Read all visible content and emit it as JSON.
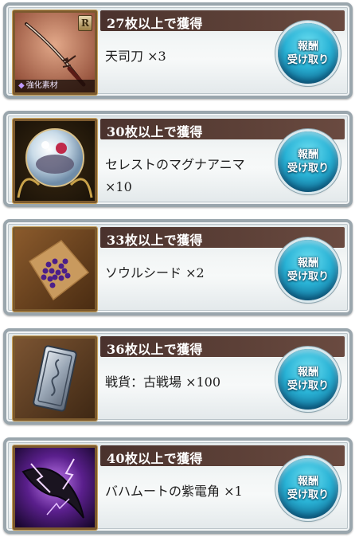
{
  "button_label_line1": "報酬",
  "button_label_line2": "受け取り",
  "rewards": [
    {
      "threshold": "27枚以上で獲得",
      "name": "天司刀 ×3",
      "badge": "R",
      "tag": "強化素材",
      "icon": "sword-item-icon"
    },
    {
      "threshold": "30枚以上で獲得",
      "name": "セレストのマグナアニマ ×10",
      "icon": "crystal-orb-icon"
    },
    {
      "threshold": "33枚以上で獲得",
      "name": "ソウルシード ×2",
      "icon": "soul-seeds-icon"
    },
    {
      "threshold": "36枚以上で獲得",
      "name": "戦貨：古戦場 ×100",
      "icon": "silver-token-icon"
    },
    {
      "threshold": "40枚以上で獲得",
      "name": "バハムートの紫電角 ×1",
      "icon": "purple-horn-icon"
    }
  ]
}
